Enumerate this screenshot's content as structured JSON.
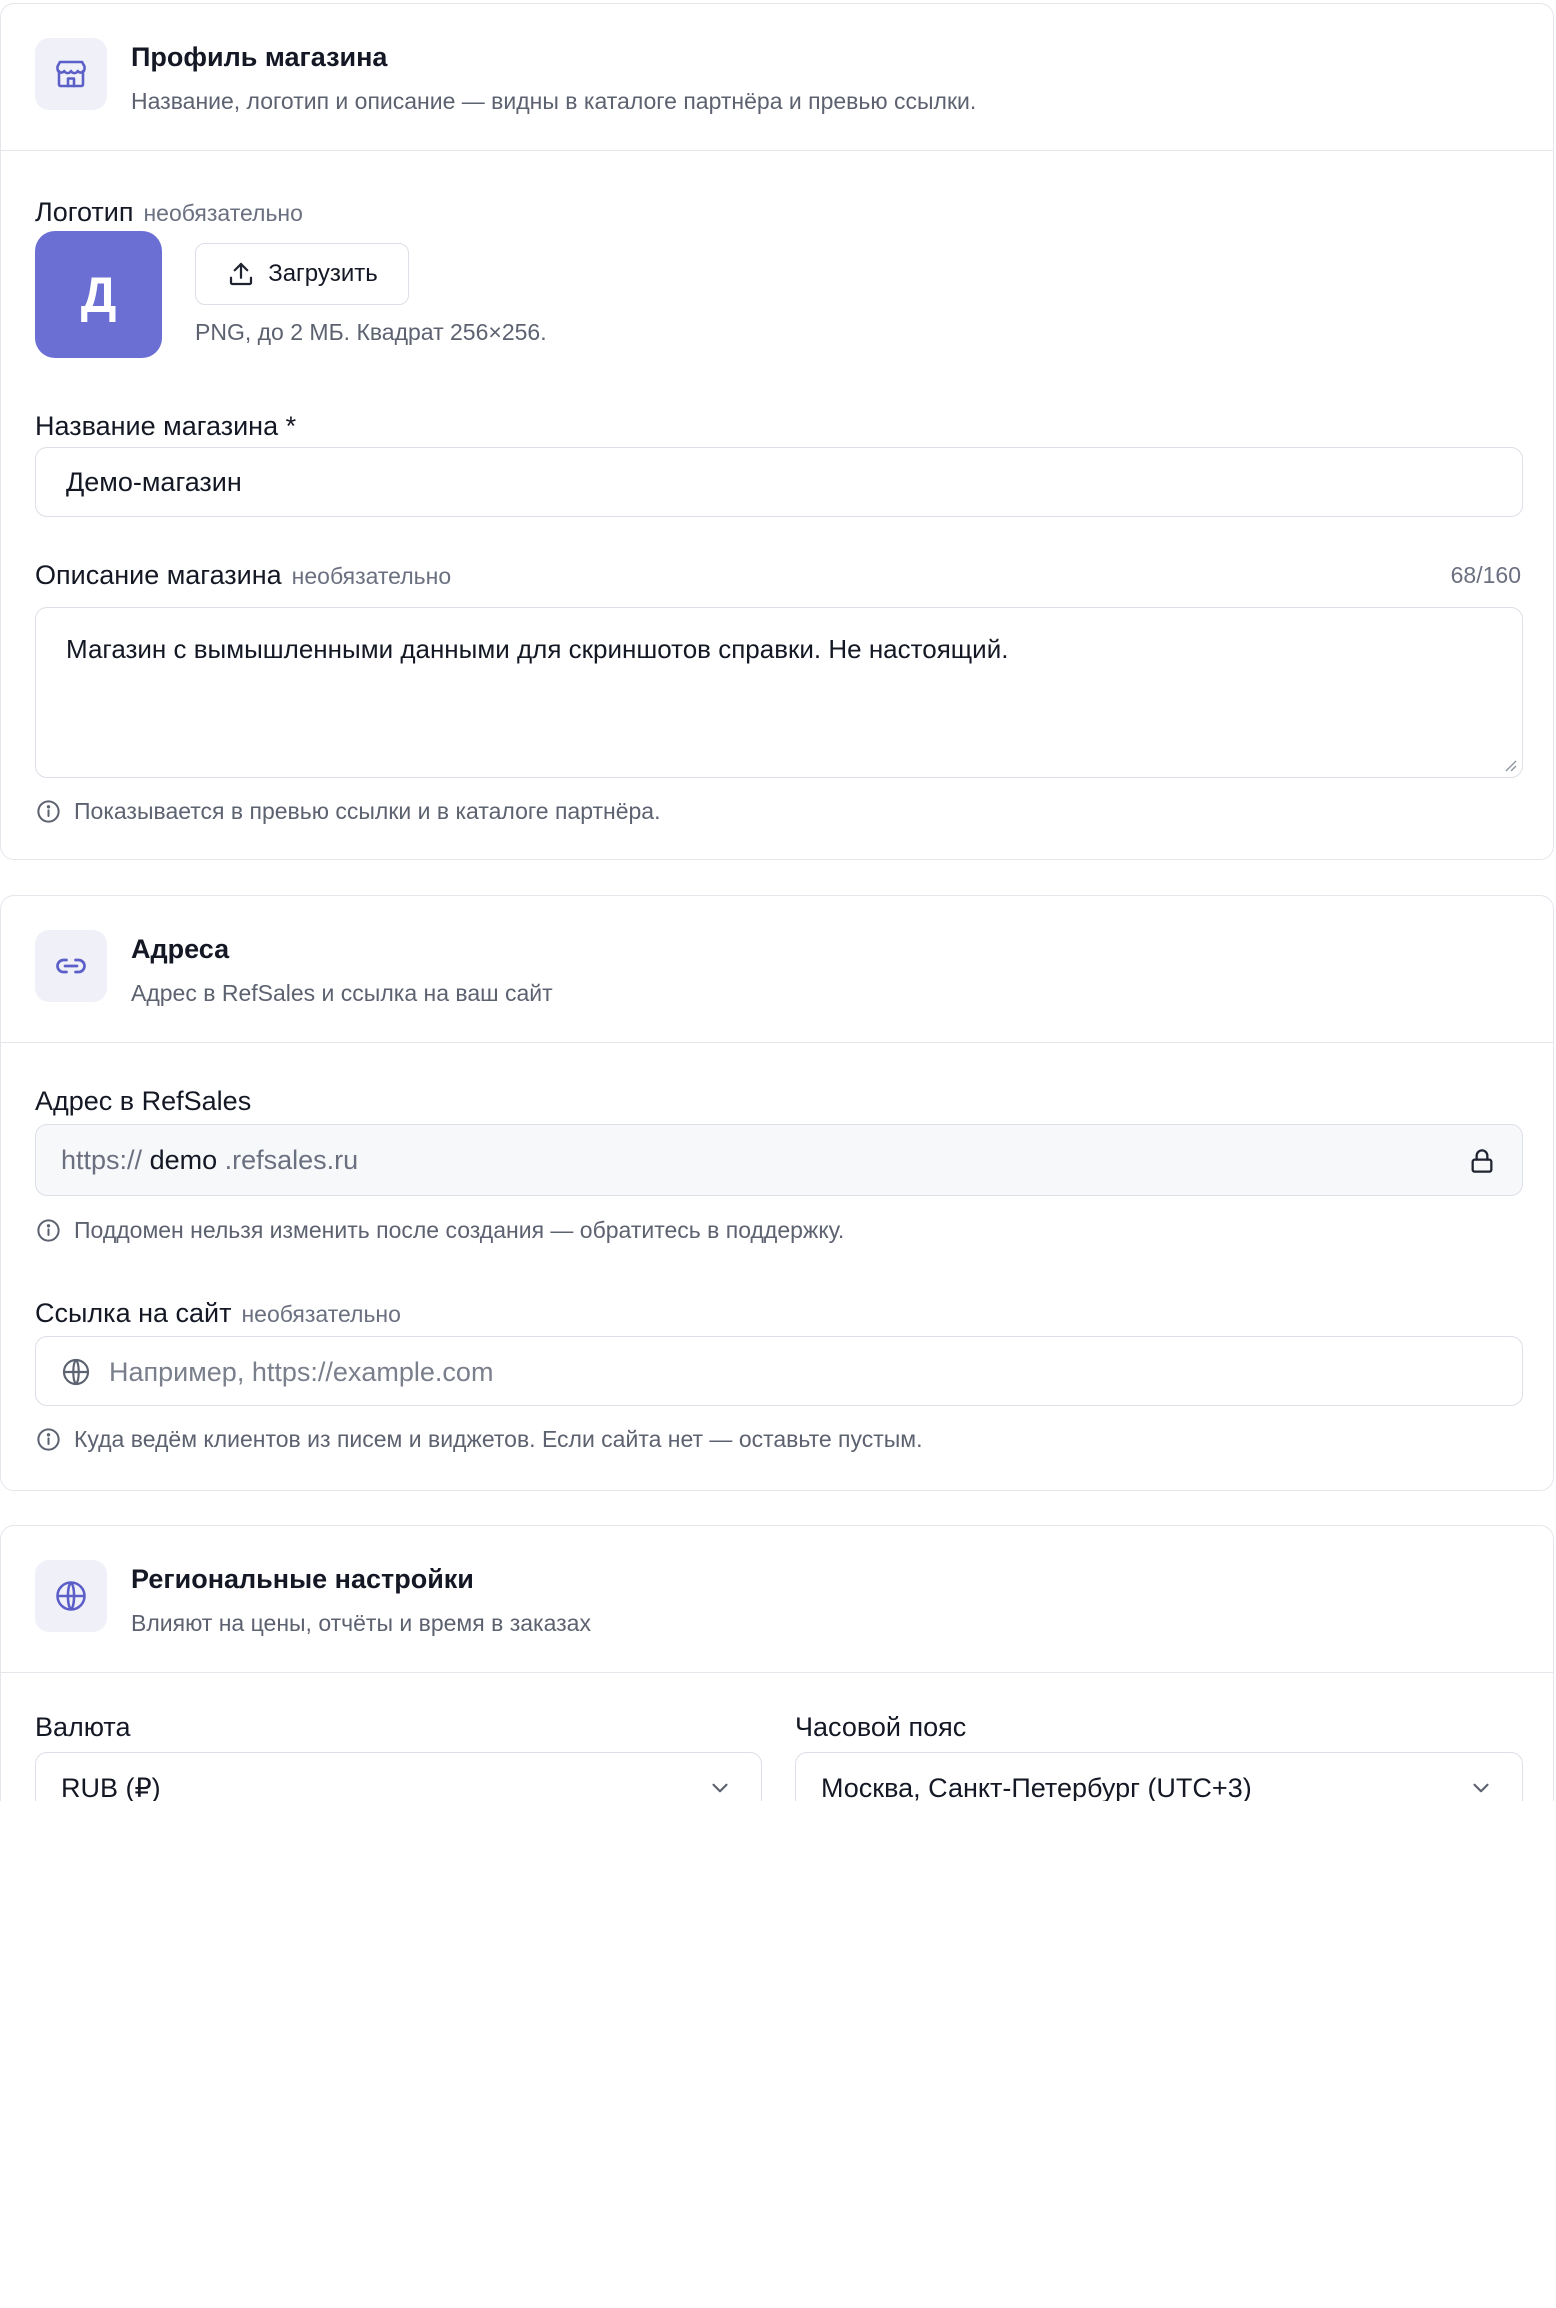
{
  "profile": {
    "title": "Профиль магазина",
    "subtitle": "Название, логотип и описание — видны в каталоге партнёра и превью ссылки.",
    "icon": "store-icon",
    "logo": {
      "label": "Логотип",
      "optional": "необязательно",
      "letter": "Д",
      "upload_label": "Загрузить",
      "hint": "PNG, до 2 МБ. Квадрат 256×256.",
      "color": "#6b6fd4"
    },
    "name": {
      "label": "Название магазина *",
      "value": "Демо-магазин"
    },
    "description": {
      "label": "Описание магазина",
      "optional": "необязательно",
      "counter": "68/160",
      "value": "Магазин с вымышленными данными для скриншотов справки. Не настоящий.",
      "hint": "Показывается в превью ссылки и в каталоге партнёра."
    }
  },
  "addresses": {
    "title": "Адреса",
    "subtitle": "Адрес в RefSales и ссылка на ваш сайт",
    "icon": "link-icon",
    "refsales": {
      "label": "Адрес в RefSales",
      "prefix": "https://",
      "subdomain": "demo",
      "suffix": ".refsales.ru",
      "hint": "Поддомен нельзя изменить после создания — обратитесь в поддержку."
    },
    "site": {
      "label": "Ссылка на сайт",
      "optional": "необязательно",
      "placeholder": "Например, https://example.com",
      "hint": "Куда ведём клиентов из писем и виджетов. Если сайта нет — оставьте пустым."
    }
  },
  "regional": {
    "title": "Региональные настройки",
    "subtitle": "Влияют на цены, отчёты и время в заказах",
    "icon": "globe-icon",
    "currency": {
      "label": "Валюта",
      "value": "RUB (₽)"
    },
    "timezone": {
      "label": "Часовой пояс",
      "value": "Москва, Санкт-Петербург (UTC+3)"
    }
  },
  "colors": {
    "accent": "#5b5fc7",
    "border": "#e4e6ec"
  }
}
